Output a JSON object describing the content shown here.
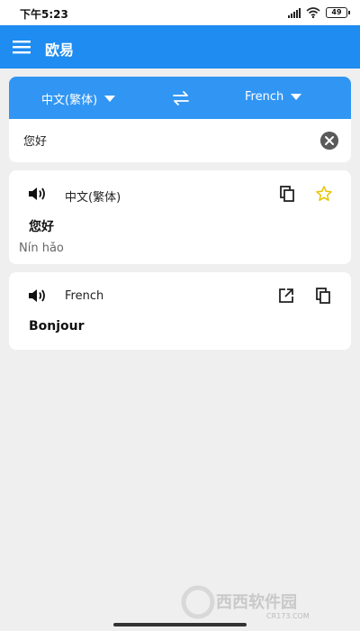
{
  "status_bar": {
    "time": "下午5:23",
    "battery": "49"
  },
  "app_bar": {
    "title": "欧易"
  },
  "lang_bar": {
    "source": "中文(繁体)",
    "target": "French"
  },
  "input": {
    "text": "您好"
  },
  "source_card": {
    "lang": "中文(繁体)",
    "text": "您好",
    "romanization": "Nín hǎo"
  },
  "target_card": {
    "lang": "French",
    "text": "Bonjour"
  },
  "watermark": {
    "text": "西西软件园",
    "url": "CR173.COM"
  },
  "colors": {
    "primary": "#1e8cf0",
    "lang_bar": "#3196f3",
    "star": "#e8c400",
    "background": "#efefef"
  },
  "icons": [
    "menu-icon",
    "swap-icon",
    "clear-icon",
    "speaker-icon",
    "copy-icon",
    "star-icon",
    "open-external-icon"
  ]
}
